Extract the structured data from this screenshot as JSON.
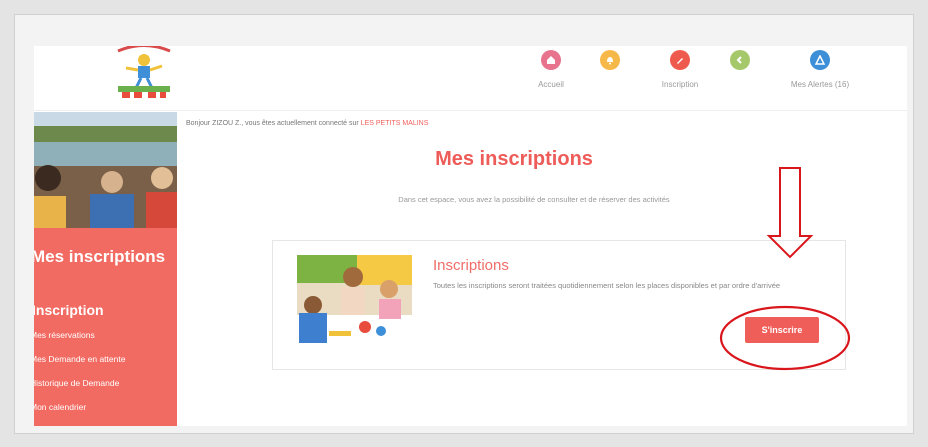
{
  "nav": {
    "items": [
      {
        "label": "Accueil",
        "color": "#e8738c",
        "icon": "home-icon"
      },
      {
        "label": "",
        "color": "#f7b84a",
        "icon": "bell-icon"
      },
      {
        "label": "Inscription",
        "color": "#ee5a4e",
        "icon": "pencil-icon"
      },
      {
        "label": "",
        "color": "#a4c86a",
        "icon": "chevron-icon"
      },
      {
        "label": "Mes Alertes (16)",
        "color": "#3d8fd8",
        "icon": "alert-icon"
      }
    ]
  },
  "welcome": {
    "prefix": "Bonjour ZIZOU Z., vous êtes actuellement connecté sur ",
    "site": "LES PETITS MALINS"
  },
  "sidebar": {
    "title": "Mes inscriptions",
    "section": "Inscription",
    "links": [
      "Mes réservations",
      "Mes Demande en attente",
      "Historique de Demande",
      "Mon calendrier"
    ]
  },
  "main": {
    "title": "Mes inscriptions",
    "subtitle": "Dans cet espace, vous avez la possibilité de consulter et de réserver des activités"
  },
  "card": {
    "title": "Inscriptions",
    "text": "Toutes les inscriptions seront traitées quotidiennement selon les places disponibles et par ordre d'arrivée",
    "button_label": "S'inscrire"
  },
  "colors": {
    "accent": "#ee5c59",
    "sidebar": "#f26b62",
    "annotation": "#d9161c"
  }
}
